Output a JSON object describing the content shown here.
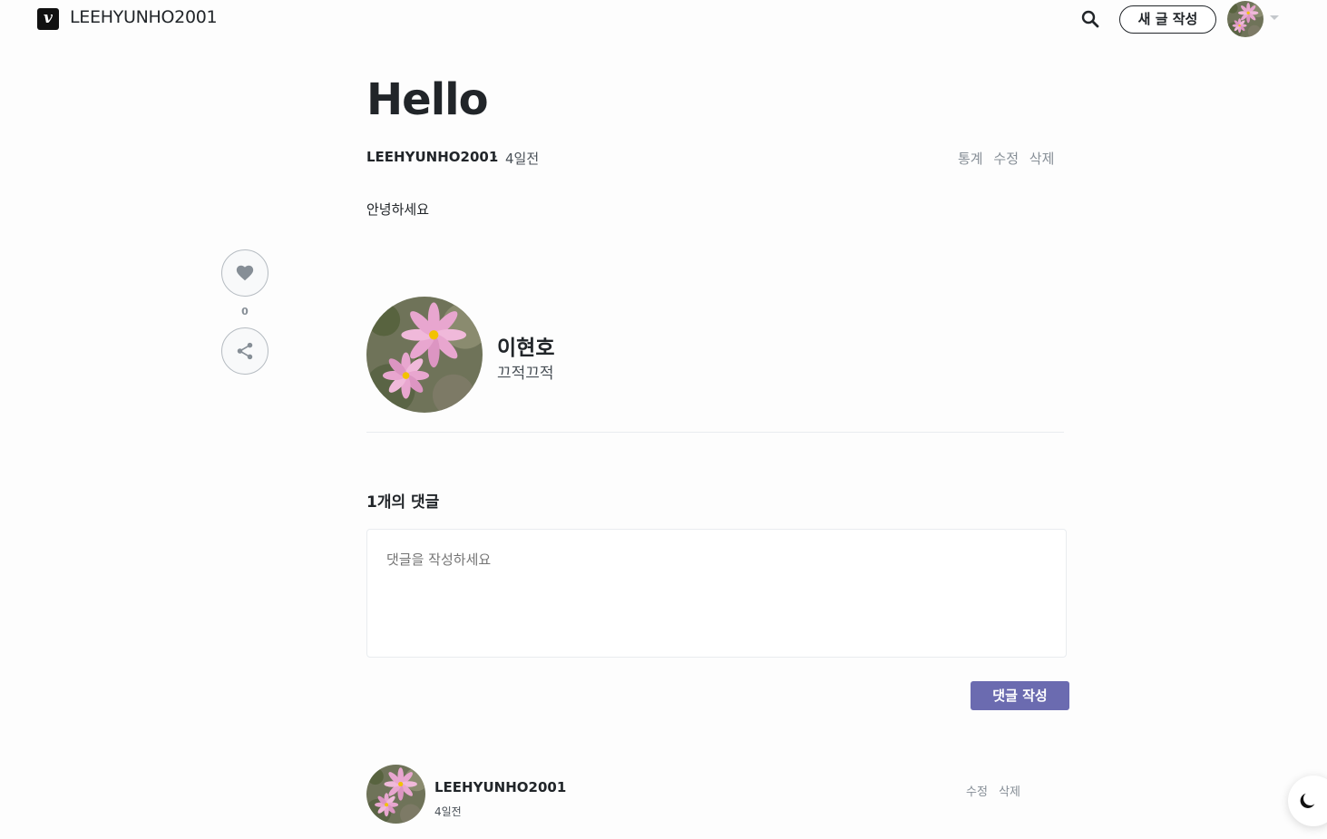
{
  "header": {
    "logo_letter": "v",
    "blog_name": "LEEHYUNHO2001",
    "new_post_label": "새 글 작성"
  },
  "post": {
    "title": "Hello",
    "author": "LEEHYUNHO2001",
    "separator": "·",
    "date": "4일전",
    "actions": {
      "stats": "통계",
      "edit": "수정",
      "delete": "삭제"
    },
    "body": "안녕하세요"
  },
  "side": {
    "like_count": "0"
  },
  "profile": {
    "name": "이현호",
    "description": "끄적끄적"
  },
  "comments": {
    "count_label": "1개의 댓글",
    "input_placeholder": "댓글을 작성하세요",
    "submit_label": "댓글 작성",
    "items": [
      {
        "author": "LEEHYUNHO2001",
        "date": "4일전",
        "edit": "수정",
        "delete": "삭제"
      }
    ]
  },
  "colors": {
    "accent": "#6b6bb0",
    "text": "#212529",
    "muted": "#868e96"
  }
}
